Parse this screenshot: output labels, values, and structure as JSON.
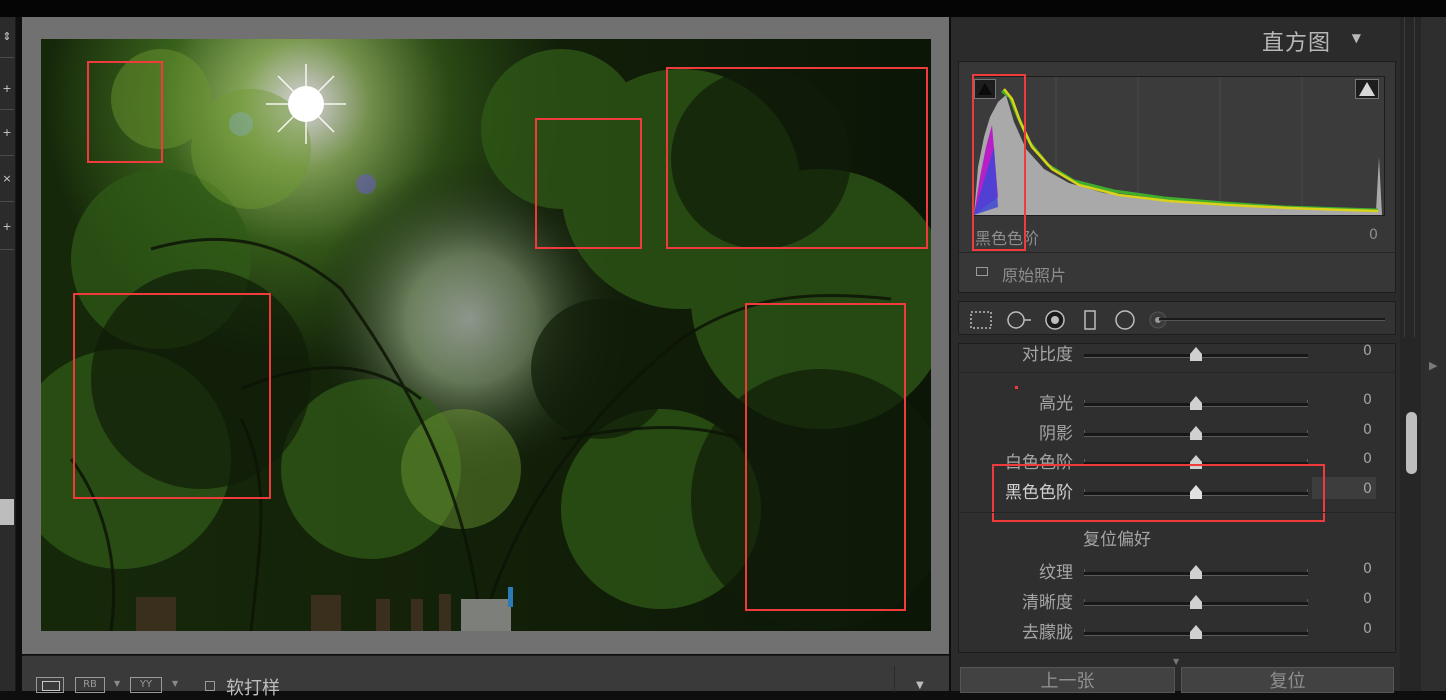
{
  "histogram": {
    "title": "直方图",
    "readout_label": "黑色色阶",
    "readout_value": "0",
    "original_photo_label": "原始照片"
  },
  "sliders": [
    {
      "label": "对比度",
      "value": "0",
      "position": 0.5
    },
    {
      "label": "高光",
      "value": "0",
      "position": 0.5
    },
    {
      "label": "阴影",
      "value": "0",
      "position": 0.5
    },
    {
      "label": "白色色阶",
      "value": "0",
      "position": 0.5
    },
    {
      "label": "黑色色阶",
      "value": "0",
      "position": 0.5
    },
    {
      "label": "纹理",
      "value": "0",
      "position": 0.5
    },
    {
      "label": "清晰度",
      "value": "0",
      "position": 0.5
    },
    {
      "label": "去朦胧",
      "value": "0",
      "position": 0.5
    }
  ],
  "reset_preference": "复位偏好",
  "footer": {
    "previous_label": "上一张",
    "reset_label": "复位"
  },
  "toolbar": {
    "soft_proof_label": "软打样",
    "compare_label": "RB",
    "survey_label": "YY"
  },
  "colors": {
    "annotation": "#ef3b3b",
    "panel": "#2b2b2b",
    "image_bg": "#717171"
  },
  "icons": {
    "left_panel": [
      "sort-icon",
      "add-icon",
      "add-icon",
      "close-icon",
      "add-icon"
    ],
    "tools": [
      "crop-overlay-icon",
      "spot-removal-icon",
      "red-eye-icon",
      "graduated-filter-icon",
      "radial-filter-icon",
      "adjustment-brush-icon"
    ]
  }
}
